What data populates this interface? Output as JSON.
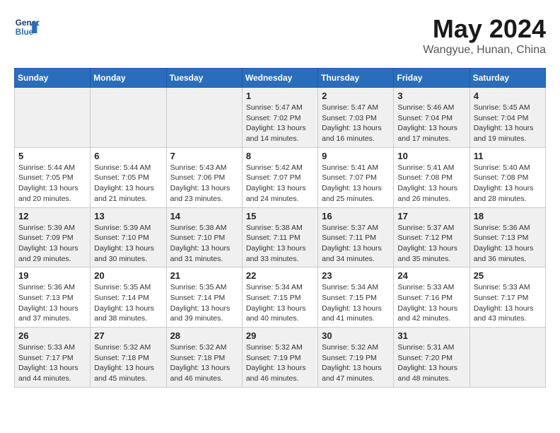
{
  "header": {
    "logo_line1": "General",
    "logo_line2": "Blue",
    "month": "May 2024",
    "location": "Wangyue, Hunan, China"
  },
  "days_of_week": [
    "Sunday",
    "Monday",
    "Tuesday",
    "Wednesday",
    "Thursday",
    "Friday",
    "Saturday"
  ],
  "weeks": [
    [
      {
        "day": "",
        "info": ""
      },
      {
        "day": "",
        "info": ""
      },
      {
        "day": "",
        "info": ""
      },
      {
        "day": "1",
        "info": "Sunrise: 5:47 AM\nSunset: 7:02 PM\nDaylight: 13 hours and 14 minutes."
      },
      {
        "day": "2",
        "info": "Sunrise: 5:47 AM\nSunset: 7:03 PM\nDaylight: 13 hours and 16 minutes."
      },
      {
        "day": "3",
        "info": "Sunrise: 5:46 AM\nSunset: 7:04 PM\nDaylight: 13 hours and 17 minutes."
      },
      {
        "day": "4",
        "info": "Sunrise: 5:45 AM\nSunset: 7:04 PM\nDaylight: 13 hours and 19 minutes."
      }
    ],
    [
      {
        "day": "5",
        "info": "Sunrise: 5:44 AM\nSunset: 7:05 PM\nDaylight: 13 hours and 20 minutes."
      },
      {
        "day": "6",
        "info": "Sunrise: 5:44 AM\nSunset: 7:05 PM\nDaylight: 13 hours and 21 minutes."
      },
      {
        "day": "7",
        "info": "Sunrise: 5:43 AM\nSunset: 7:06 PM\nDaylight: 13 hours and 23 minutes."
      },
      {
        "day": "8",
        "info": "Sunrise: 5:42 AM\nSunset: 7:07 PM\nDaylight: 13 hours and 24 minutes."
      },
      {
        "day": "9",
        "info": "Sunrise: 5:41 AM\nSunset: 7:07 PM\nDaylight: 13 hours and 25 minutes."
      },
      {
        "day": "10",
        "info": "Sunrise: 5:41 AM\nSunset: 7:08 PM\nDaylight: 13 hours and 26 minutes."
      },
      {
        "day": "11",
        "info": "Sunrise: 5:40 AM\nSunset: 7:08 PM\nDaylight: 13 hours and 28 minutes."
      }
    ],
    [
      {
        "day": "12",
        "info": "Sunrise: 5:39 AM\nSunset: 7:09 PM\nDaylight: 13 hours and 29 minutes."
      },
      {
        "day": "13",
        "info": "Sunrise: 5:39 AM\nSunset: 7:10 PM\nDaylight: 13 hours and 30 minutes."
      },
      {
        "day": "14",
        "info": "Sunrise: 5:38 AM\nSunset: 7:10 PM\nDaylight: 13 hours and 31 minutes."
      },
      {
        "day": "15",
        "info": "Sunrise: 5:38 AM\nSunset: 7:11 PM\nDaylight: 13 hours and 33 minutes."
      },
      {
        "day": "16",
        "info": "Sunrise: 5:37 AM\nSunset: 7:11 PM\nDaylight: 13 hours and 34 minutes."
      },
      {
        "day": "17",
        "info": "Sunrise: 5:37 AM\nSunset: 7:12 PM\nDaylight: 13 hours and 35 minutes."
      },
      {
        "day": "18",
        "info": "Sunrise: 5:36 AM\nSunset: 7:13 PM\nDaylight: 13 hours and 36 minutes."
      }
    ],
    [
      {
        "day": "19",
        "info": "Sunrise: 5:36 AM\nSunset: 7:13 PM\nDaylight: 13 hours and 37 minutes."
      },
      {
        "day": "20",
        "info": "Sunrise: 5:35 AM\nSunset: 7:14 PM\nDaylight: 13 hours and 38 minutes."
      },
      {
        "day": "21",
        "info": "Sunrise: 5:35 AM\nSunset: 7:14 PM\nDaylight: 13 hours and 39 minutes."
      },
      {
        "day": "22",
        "info": "Sunrise: 5:34 AM\nSunset: 7:15 PM\nDaylight: 13 hours and 40 minutes."
      },
      {
        "day": "23",
        "info": "Sunrise: 5:34 AM\nSunset: 7:15 PM\nDaylight: 13 hours and 41 minutes."
      },
      {
        "day": "24",
        "info": "Sunrise: 5:33 AM\nSunset: 7:16 PM\nDaylight: 13 hours and 42 minutes."
      },
      {
        "day": "25",
        "info": "Sunrise: 5:33 AM\nSunset: 7:17 PM\nDaylight: 13 hours and 43 minutes."
      }
    ],
    [
      {
        "day": "26",
        "info": "Sunrise: 5:33 AM\nSunset: 7:17 PM\nDaylight: 13 hours and 44 minutes."
      },
      {
        "day": "27",
        "info": "Sunrise: 5:32 AM\nSunset: 7:18 PM\nDaylight: 13 hours and 45 minutes."
      },
      {
        "day": "28",
        "info": "Sunrise: 5:32 AM\nSunset: 7:18 PM\nDaylight: 13 hours and 46 minutes."
      },
      {
        "day": "29",
        "info": "Sunrise: 5:32 AM\nSunset: 7:19 PM\nDaylight: 13 hours and 46 minutes."
      },
      {
        "day": "30",
        "info": "Sunrise: 5:32 AM\nSunset: 7:19 PM\nDaylight: 13 hours and 47 minutes."
      },
      {
        "day": "31",
        "info": "Sunrise: 5:31 AM\nSunset: 7:20 PM\nDaylight: 13 hours and 48 minutes."
      },
      {
        "day": "",
        "info": ""
      }
    ]
  ],
  "gray_rows": [
    0,
    2,
    4
  ]
}
